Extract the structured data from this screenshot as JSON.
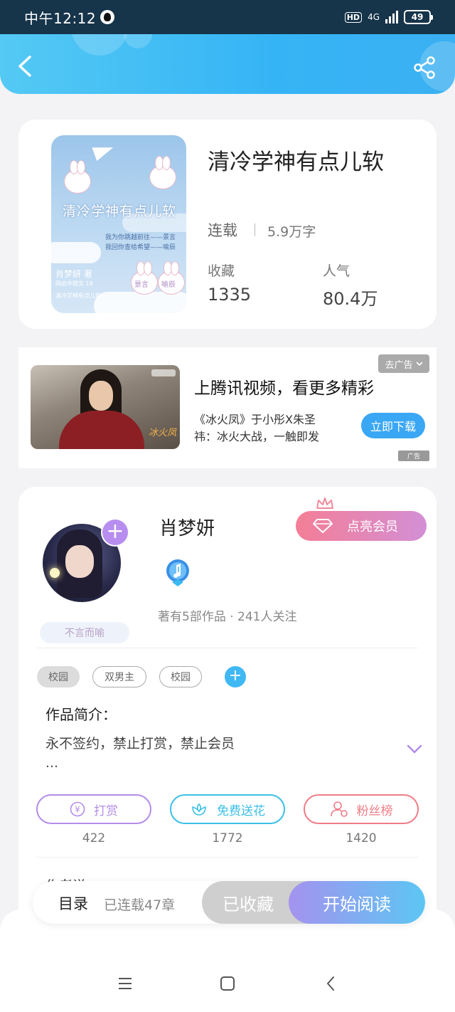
{
  "status_bar": {
    "time": "中午12:12",
    "hd": "HD",
    "network": "4G",
    "battery": "49"
  },
  "book": {
    "title": "清冷学神有点儿软",
    "status": "连载",
    "word_count": "5.9万字",
    "stats": [
      {
        "label": "收藏",
        "value": "1335"
      },
      {
        "label": "人气",
        "value": "80.4万"
      }
    ],
    "cover": {
      "title": "清冷学神有点儿软",
      "line1": "我为你跳越前往——景言",
      "line2": "我回你查给希望——喻辰",
      "author": "肖梦妍 著",
      "publisher": "网启中国文 18",
      "publisher2": "清冷学神有点儿软",
      "stamp_left": "景言",
      "stamp_right": "喻辰"
    }
  },
  "ad": {
    "close_label": "去广告",
    "title": "上腾讯视频，看更多精彩",
    "line1": "《冰火凤》于小彤X朱圣",
    "line2": "祎：冰火大战，一触即发",
    "download_label": "立即下载",
    "tag": "广告",
    "image_mark": "冰火凤"
  },
  "author": {
    "name": "肖梦妍",
    "vip_label": "点亮会员",
    "nickname_badge": "不言而喻",
    "meta": "著有5部作品 · 241人关注"
  },
  "tags": [
    "校园",
    "双男主",
    "校园"
  ],
  "intro": {
    "title": "作品简介：",
    "text": "永不签约，禁止打赏，禁止会员",
    "ellipsis": "…"
  },
  "actions": [
    {
      "label": "打赏",
      "count": "422",
      "color": "#b48de8"
    },
    {
      "label": "免费送花",
      "count": "1772",
      "color": "#3cc0e6"
    },
    {
      "label": "粉丝榜",
      "count": "1420",
      "color": "#ef7d86"
    }
  ],
  "peek_text": "作者说",
  "bottom_bar": {
    "toc_label": "目录",
    "toc_sub": "已连载47章",
    "fav_label": "已收藏",
    "read_label": "开始阅读"
  },
  "icons": [
    "back-icon",
    "share-icon",
    "plus-icon",
    "crown-icon",
    "diamond-icon",
    "music-note-badge-icon",
    "chevron-down-icon",
    "yen-coin-icon",
    "flower-icon",
    "user-rank-icon",
    "menu-icon",
    "home-square-icon",
    "nav-back-icon"
  ]
}
